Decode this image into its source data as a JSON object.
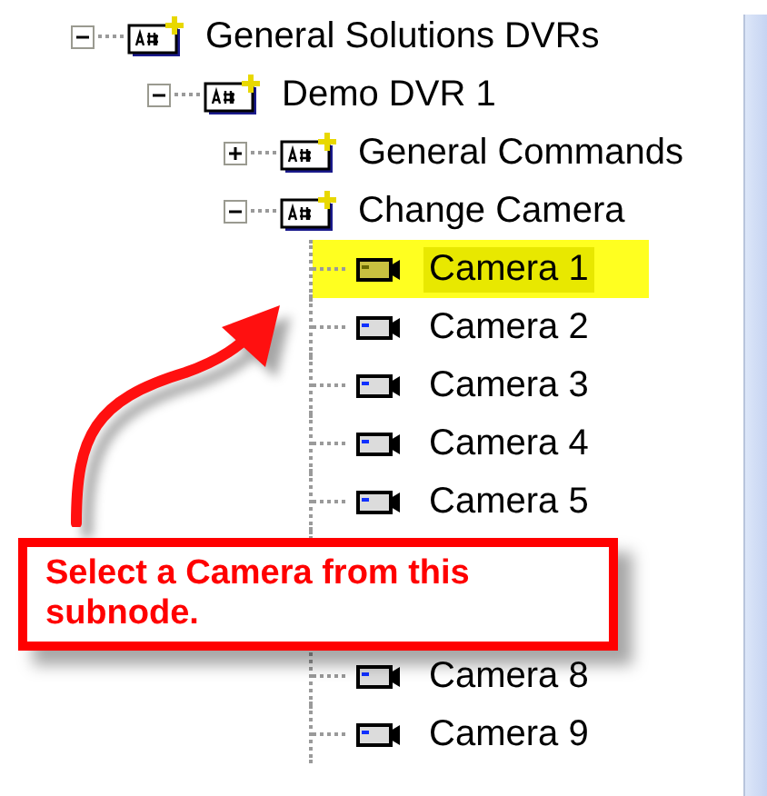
{
  "tree": [
    {
      "label": "General Solutions DVRs",
      "kind": "folder",
      "expanded": true,
      "children": [
        {
          "label": "Demo DVR 1",
          "kind": "folder",
          "expanded": true,
          "children": [
            {
              "label": "General Commands",
              "kind": "folder",
              "expanded": false
            },
            {
              "label": "Change Camera",
              "kind": "folder",
              "expanded": true,
              "children": [
                {
                  "label": "Camera 1",
                  "kind": "camera",
                  "selected": true
                },
                {
                  "label": "Camera 2",
                  "kind": "camera",
                  "selected": false
                },
                {
                  "label": "Camera 3",
                  "kind": "camera",
                  "selected": false
                },
                {
                  "label": "Camera 4",
                  "kind": "camera",
                  "selected": false
                },
                {
                  "label": "Camera 5",
                  "kind": "camera",
                  "selected": false
                },
                {
                  "kind": "covered"
                },
                {
                  "kind": "covered"
                },
                {
                  "label": "Camera 8",
                  "kind": "camera",
                  "selected": false
                },
                {
                  "label": "Camera 9",
                  "kind": "camera",
                  "selected": false
                }
              ]
            }
          ]
        }
      ]
    }
  ],
  "callout": {
    "text": "Select a Camera from this subnode."
  }
}
